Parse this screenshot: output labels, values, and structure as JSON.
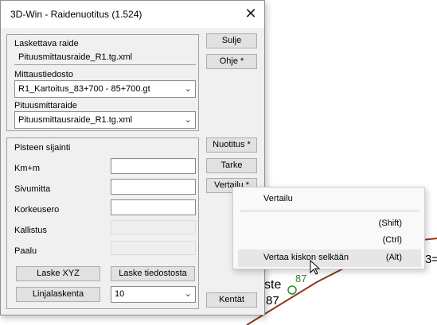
{
  "window": {
    "title": "3D-Win - Raidenuotitus  (1.524)"
  },
  "track_group": {
    "laskettava_label": "Laskettava raide",
    "laskettava_value": "Pituusmittausraide_R1.tg.xml",
    "mittaus_label": "Mittaustiedosto",
    "mittaus_value": "R1_Kartoitus_83+700 - 85+700.gt",
    "pituus_label": "Pituusmittaraide",
    "pituus_value": "Pituusmittausraide_R1.tg.xml"
  },
  "point_group": {
    "title": "Pisteen sijainti",
    "km_label": "Km+m",
    "sivumitta_label": "Sivumitta",
    "korkeusero_label": "Korkeusero",
    "kallistus_label": "Kallistus",
    "paalu_label": "Paalu",
    "laske_xyz": "Laske XYZ",
    "laske_tiedostosta": "Laske tiedostosta",
    "linjalaskenta": "Linjalaskenta",
    "linja_value": "10"
  },
  "buttons": {
    "sulje": "Sulje",
    "ohje": "Ohje *",
    "nuotitus": "Nuotitus *",
    "tarke": "Tarke",
    "vertailu": "Vertailu *",
    "kentat": "Kentät"
  },
  "menu": {
    "item1": "Vertailu",
    "item2_key": "(Shift)",
    "item3_key": "(Ctrl)",
    "item4": "Vertaa kiskon selkään",
    "item4_key": "(Alt)"
  },
  "background": {
    "text_ste": "ste",
    "text_87_green": "87",
    "text_87": "87",
    "text_3eq": "3="
  },
  "colors": {
    "track_line": "#8b3a1a",
    "point_green": "#2e8b2e"
  }
}
